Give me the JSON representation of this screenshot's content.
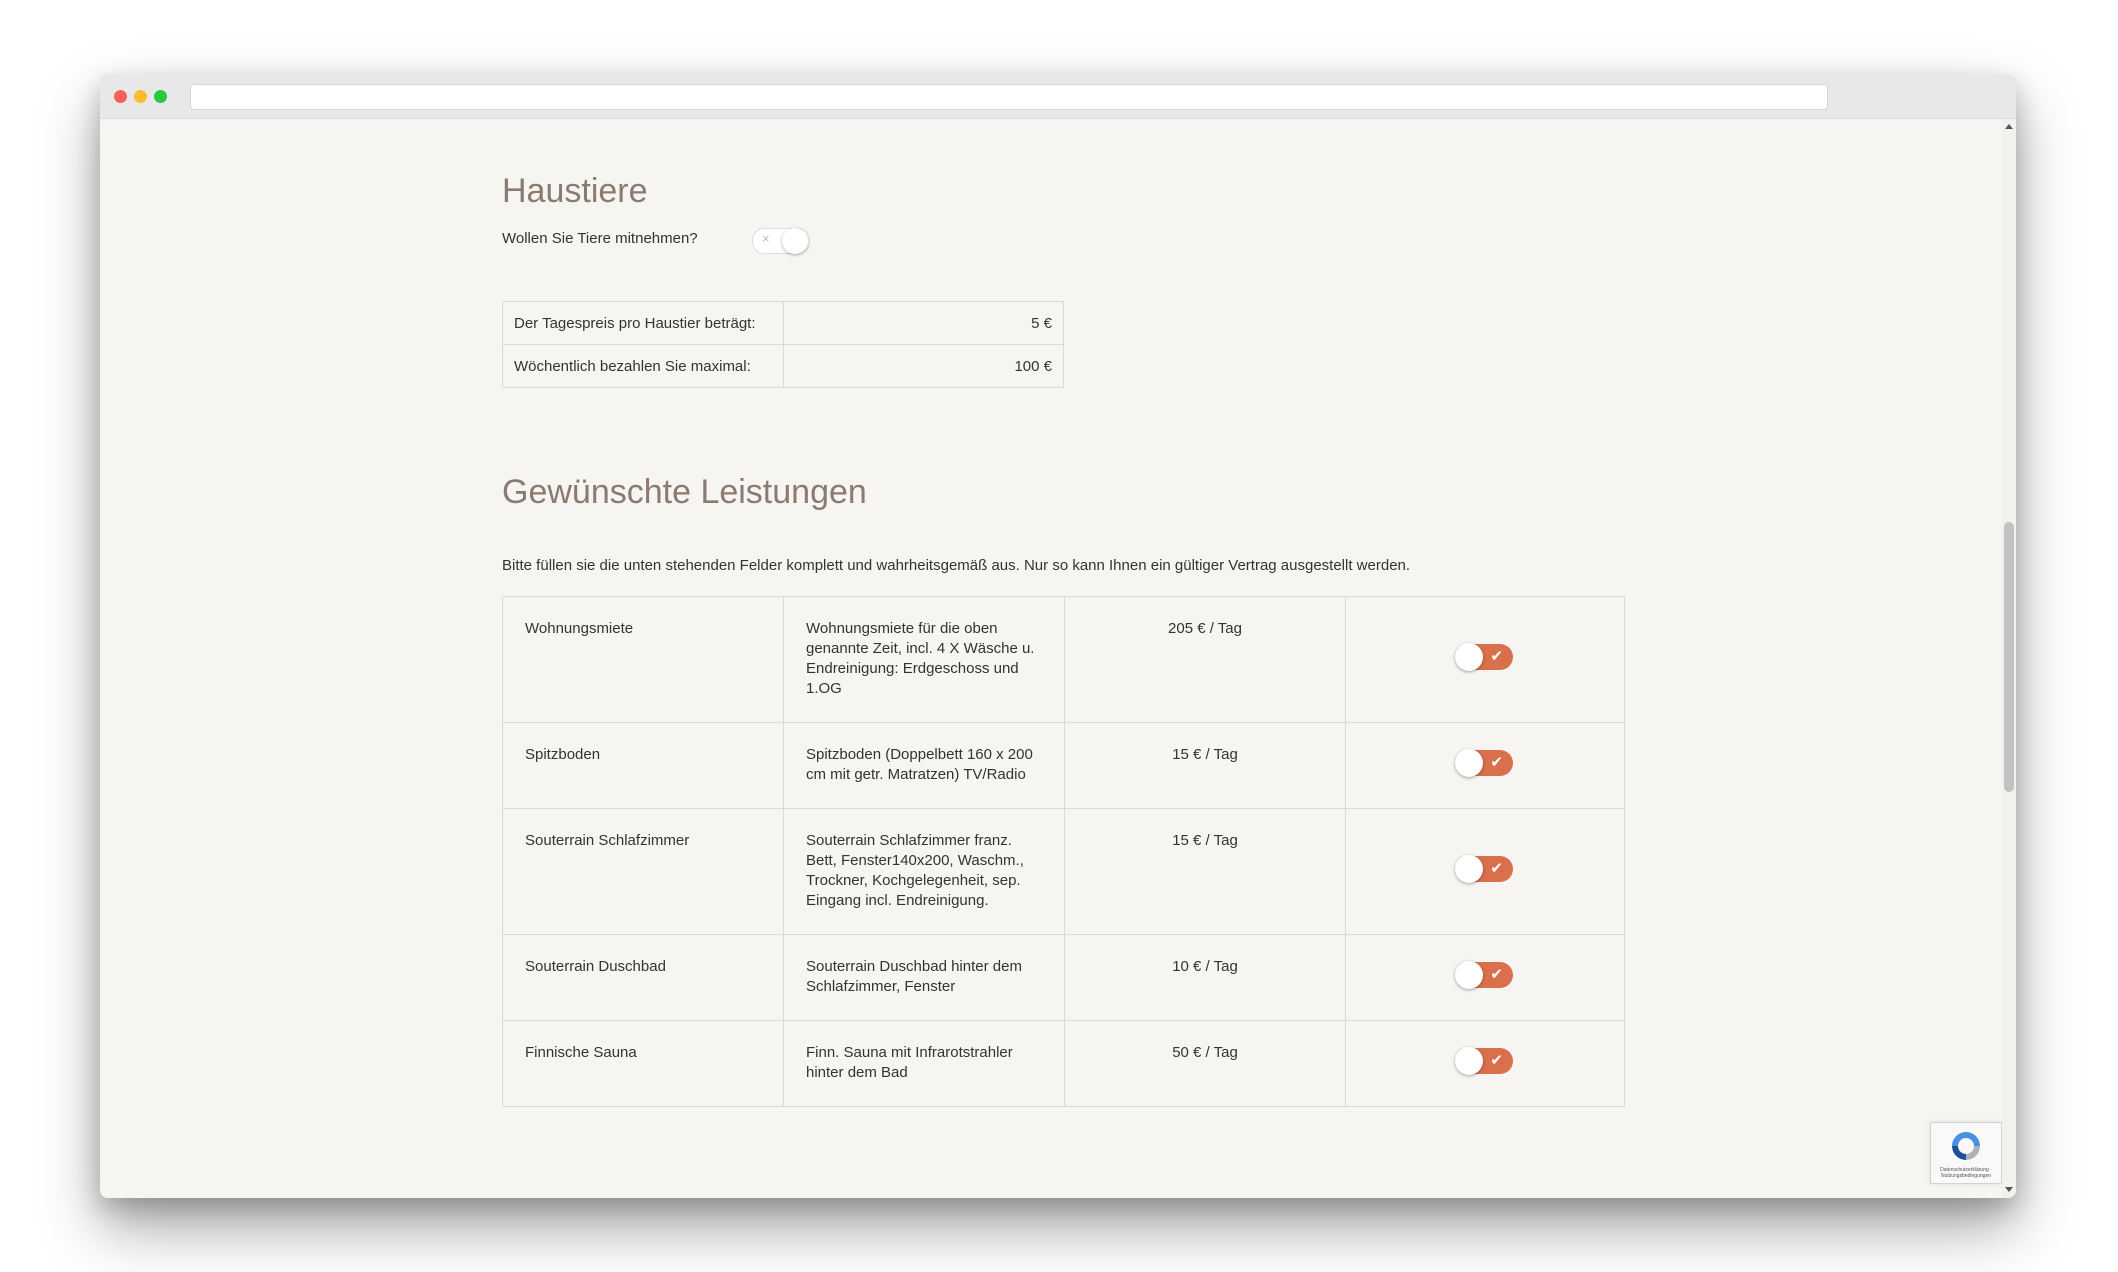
{
  "pets": {
    "heading": "Haustiere",
    "question": "Wollen Sie Tiere mitnehmen?",
    "toggle_off_symbol": "×",
    "toggle_value": false,
    "rows": [
      {
        "label": "Der Tagespreis pro Haustier beträgt:",
        "value": "5 €"
      },
      {
        "label": "Wöchentlich bezahlen Sie maximal:",
        "value": "100 €"
      }
    ]
  },
  "services": {
    "heading": "Gewünschte Leistungen",
    "intro": "Bitte füllen sie die unten stehenden Felder komplett und wahrheitsgemäß aus. Nur so kann Ihnen ein gültiger Vertrag ausgestellt werden.",
    "check_symbol": "✔",
    "items": [
      {
        "name": "Wohnungsmiete",
        "description": "Wohnungsmiete für die oben genannte Zeit, incl. 4 X Wäsche u. Endreinigung: Erdgeschoss und 1.OG",
        "price": "205 € / Tag",
        "enabled": true
      },
      {
        "name": "Spitzboden",
        "description": "Spitzboden (Doppelbett 160 x 200 cm mit getr. Matratzen) TV/Radio",
        "price": "15 € / Tag",
        "enabled": true
      },
      {
        "name": "Souterrain Schlafzimmer",
        "description": "Souterrain Schlafzimmer franz. Bett, Fenster140x200, Waschm., Trockner, Kochgelegenheit, sep. Eingang incl. Endreinigung.",
        "price": "15 € / Tag",
        "enabled": true
      },
      {
        "name": "Souterrain Duschbad",
        "description": "Souterrain Duschbad hinter dem Schlafzimmer, Fenster",
        "price": "10 € / Tag",
        "enabled": true
      },
      {
        "name": "Finnische Sauna",
        "description": "Finn. Sauna mit Infrarotstrahler hinter dem Bad",
        "price": "50 € / Tag",
        "enabled": true
      }
    ]
  },
  "recaptcha": {
    "footer": "Datenschutzerklärung · Nutzungsbedingungen"
  },
  "colors": {
    "accent": "#d9704b",
    "heading": "#8b7a70",
    "page_bg": "#f6f5f2"
  }
}
